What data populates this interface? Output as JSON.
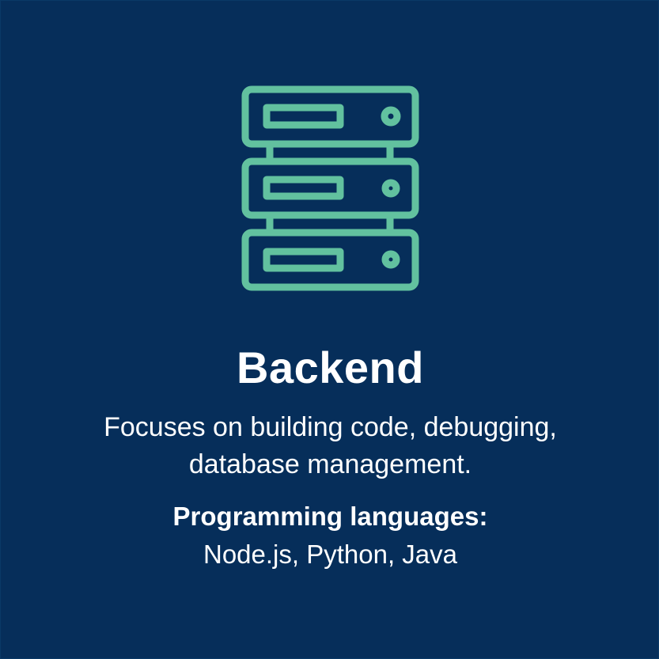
{
  "icon": {
    "name": "server-icon",
    "color": "#62c19f"
  },
  "background_color": "#062e5a",
  "card": {
    "title": "Backend",
    "description": "Focuses on building code, debugging, database management.",
    "languages_heading": "Programming languages:",
    "languages_list": "Node.js, Python, Java"
  }
}
